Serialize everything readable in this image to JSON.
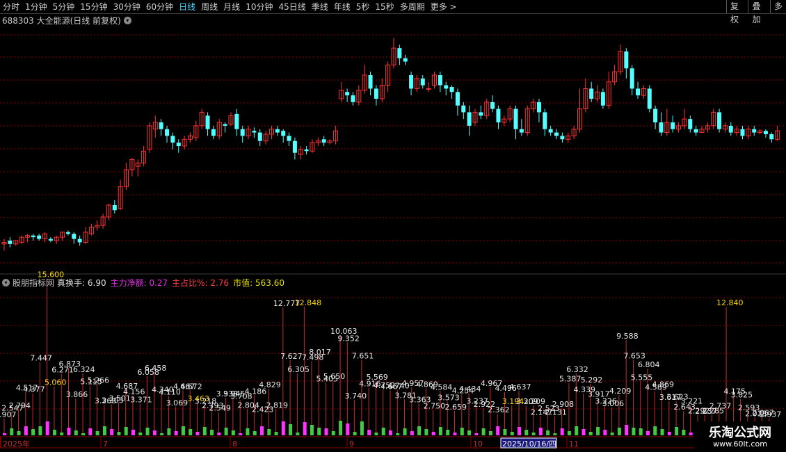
{
  "toolbar": {
    "periods": [
      "分时",
      "1分钟",
      "5分钟",
      "15分钟",
      "30分钟",
      "60分钟",
      "日线",
      "周线",
      "月线",
      "10分钟",
      "45日线",
      "季线",
      "年线",
      "5秒",
      "15秒",
      "多周期",
      "更多 >"
    ],
    "active_period": "日线",
    "right_buttons": [
      "复权",
      "叠加",
      "多"
    ]
  },
  "stock": {
    "label": "688303 大全能源(日线 前复权)"
  },
  "indicator": {
    "name": "股朋指标网",
    "items": [
      {
        "text": "真换手: 6.90",
        "color": "#e0e0e0"
      },
      {
        "text": "主力净额: 0.27",
        "color": "#e030e0"
      },
      {
        "text": "主占比%: 2.76",
        "color": "#ff4040"
      },
      {
        "text": "市值: 563.60",
        "color": "#e8e000"
      }
    ]
  },
  "colors": {
    "up": "#ff3333",
    "down": "#54ffff",
    "grid": "#8b0000",
    "bar_pink": "#ff33ff",
    "bar_green": "#43c943",
    "label_yellow": "#ffd800"
  },
  "chart_data": {
    "type": "candlestick",
    "candles": [
      [
        12,
        13,
        8,
        15
      ],
      [
        14,
        12,
        10,
        16
      ],
      [
        12,
        14,
        11,
        14
      ],
      [
        13,
        16,
        12,
        17
      ],
      [
        16,
        17,
        13,
        18
      ],
      [
        17,
        16,
        14,
        18
      ],
      [
        17,
        15,
        14,
        18
      ],
      [
        15,
        18,
        13,
        19
      ],
      [
        15,
        14,
        13,
        16
      ],
      [
        14,
        16,
        12,
        17
      ],
      [
        16,
        19,
        14,
        19
      ],
      [
        19,
        18,
        17,
        20
      ],
      [
        18,
        15,
        12,
        19
      ],
      [
        15,
        13,
        11,
        17
      ],
      [
        13,
        19,
        12,
        22
      ],
      [
        18,
        22,
        17,
        24
      ],
      [
        22,
        23,
        20,
        26
      ],
      [
        23,
        28,
        21,
        30
      ],
      [
        28,
        35,
        26,
        36
      ],
      [
        35,
        32,
        30,
        38
      ],
      [
        33,
        46,
        32,
        50
      ],
      [
        46,
        56,
        44,
        60
      ],
      [
        56,
        62,
        52,
        63
      ],
      [
        58,
        60,
        52,
        62
      ],
      [
        60,
        67,
        58,
        70
      ],
      [
        68,
        82,
        66,
        84
      ],
      [
        80,
        84,
        75,
        88
      ],
      [
        84,
        80,
        76,
        86
      ],
      [
        80,
        76,
        72,
        82
      ],
      [
        76,
        72,
        68,
        78
      ],
      [
        72,
        70,
        66,
        74
      ],
      [
        70,
        74,
        68,
        76
      ],
      [
        74,
        76,
        72,
        78
      ],
      [
        75,
        82,
        73,
        85
      ],
      [
        82,
        90,
        80,
        92
      ],
      [
        88,
        80,
        76,
        90
      ],
      [
        80,
        76,
        74,
        82
      ],
      [
        76,
        84,
        74,
        86
      ],
      [
        83,
        82,
        78,
        84
      ],
      [
        83,
        88,
        82,
        90
      ],
      [
        89,
        80,
        76,
        92
      ],
      [
        80,
        76,
        72,
        82
      ],
      [
        76,
        80,
        74,
        82
      ],
      [
        79,
        78,
        75,
        81
      ],
      [
        78,
        73,
        70,
        80
      ],
      [
        73,
        77,
        71,
        79
      ],
      [
        77,
        80,
        74,
        82
      ],
      [
        80,
        78,
        76,
        82
      ],
      [
        79,
        76,
        72,
        80
      ],
      [
        76,
        73,
        70,
        78
      ],
      [
        73,
        66,
        62,
        75
      ],
      [
        65,
        68,
        62,
        70
      ],
      [
        68,
        67,
        65,
        70
      ],
      [
        67,
        72,
        66,
        74
      ],
      [
        72,
        73,
        70,
        75
      ],
      [
        74,
        72,
        70,
        76
      ],
      [
        72,
        73,
        71,
        74
      ],
      [
        73,
        79,
        71,
        82
      ],
      [
        98,
        103,
        96,
        108
      ],
      [
        102,
        100,
        96,
        104
      ],
      [
        100,
        96,
        94,
        102
      ],
      [
        96,
        103,
        94,
        106
      ],
      [
        103,
        112,
        101,
        118
      ],
      [
        112,
        104,
        100,
        114
      ],
      [
        104,
        98,
        94,
        106
      ],
      [
        98,
        106,
        96,
        110
      ],
      [
        106,
        118,
        102,
        120
      ],
      [
        118,
        128,
        116,
        134
      ],
      [
        128,
        122,
        118,
        130
      ],
      [
        122,
        120,
        118,
        124
      ],
      [
        112,
        104,
        100,
        114
      ],
      [
        104,
        110,
        102,
        112
      ],
      [
        110,
        106,
        104,
        112
      ],
      [
        104,
        104,
        102,
        108
      ],
      [
        106,
        112,
        104,
        114
      ],
      [
        112,
        106,
        102,
        114
      ],
      [
        106,
        104,
        100,
        108
      ],
      [
        105,
        102,
        98,
        106
      ],
      [
        102,
        94,
        88,
        104
      ],
      [
        94,
        90,
        86,
        96
      ],
      [
        90,
        82,
        76,
        94
      ],
      [
        84,
        90,
        82,
        92
      ],
      [
        90,
        88,
        86,
        94
      ],
      [
        88,
        96,
        86,
        98
      ],
      [
        96,
        92,
        90,
        100
      ],
      [
        92,
        84,
        80,
        94
      ],
      [
        84,
        86,
        82,
        88
      ],
      [
        86,
        92,
        84,
        94
      ],
      [
        92,
        80,
        74,
        94
      ],
      [
        80,
        78,
        76,
        86
      ],
      [
        78,
        92,
        76,
        94
      ],
      [
        92,
        96,
        90,
        98
      ],
      [
        96,
        90,
        84,
        98
      ],
      [
        90,
        80,
        76,
        92
      ],
      [
        80,
        78,
        76,
        82
      ],
      [
        78,
        76,
        74,
        80
      ],
      [
        76,
        74,
        72,
        78
      ],
      [
        74,
        76,
        72,
        78
      ],
      [
        76,
        80,
        74,
        82
      ],
      [
        80,
        92,
        78,
        104
      ],
      [
        92,
        104,
        90,
        110
      ],
      [
        104,
        98,
        96,
        108
      ],
      [
        98,
        102,
        96,
        106
      ],
      [
        102,
        94,
        92,
        104
      ],
      [
        94,
        108,
        92,
        114
      ],
      [
        108,
        114,
        106,
        118
      ],
      [
        114,
        126,
        112,
        130
      ],
      [
        126,
        116,
        110,
        128
      ],
      [
        116,
        104,
        100,
        118
      ],
      [
        104,
        100,
        98,
        108
      ],
      [
        100,
        104,
        98,
        106
      ],
      [
        104,
        92,
        90,
        106
      ],
      [
        92,
        84,
        80,
        94
      ],
      [
        84,
        78,
        76,
        90
      ],
      [
        78,
        84,
        76,
        92
      ],
      [
        84,
        80,
        78,
        88
      ],
      [
        80,
        82,
        78,
        84
      ],
      [
        82,
        86,
        80,
        92
      ],
      [
        86,
        80,
        78,
        88
      ],
      [
        80,
        78,
        76,
        82
      ],
      [
        78,
        80,
        78,
        82
      ],
      [
        80,
        82,
        78,
        84
      ],
      [
        82,
        90,
        80,
        92
      ],
      [
        90,
        80,
        78,
        92
      ],
      [
        80,
        82,
        78,
        84
      ],
      [
        82,
        78,
        76,
        84
      ],
      [
        78,
        80,
        76,
        82
      ],
      [
        80,
        76,
        74,
        82
      ],
      [
        76,
        80,
        74,
        82
      ],
      [
        80,
        78,
        76,
        82
      ],
      [
        78,
        79,
        77,
        80
      ],
      [
        79,
        77,
        75,
        80
      ],
      [
        77,
        74,
        72,
        78
      ],
      [
        74,
        79,
        73,
        82
      ]
    ],
    "volume_labels": [
      "1.907",
      "2.547",
      "2.794",
      "4.517",
      "4.377",
      "7.447",
      "15.600",
      "5.060",
      "6.271",
      "6.873",
      "3.866",
      "6.324",
      "5.115",
      "5.266",
      "3.263",
      "3.303",
      "3.501",
      "4.687",
      "4.156",
      "3.371",
      "6.058",
      "6.458",
      "4.340",
      "4.110",
      "3.069",
      "4.667",
      "4.672",
      "3.463",
      "3.218",
      "2.793",
      "2.549",
      "3.938",
      "3.945",
      "3.708",
      "2.804",
      "4.186",
      "2.423",
      "4.829",
      "2.819",
      "12.777",
      "7.627",
      "6.305",
      "12.848",
      "7.498",
      "8.017",
      "5.405",
      "5.650",
      "10.063",
      "9.352",
      "3.740",
      "7.651",
      "4.916",
      "5.569",
      "4.752",
      "4.667",
      "4.740",
      "3.781",
      "4.957",
      "3.363",
      "4.869",
      "2.750",
      "4.584",
      "3.573",
      "2.659",
      "4.254",
      "4.434",
      "3.237",
      "2.922",
      "4.967",
      "2.362",
      "4.496",
      "3.194",
      "4.637",
      "3.209",
      "3.209",
      "2.147",
      "2.523",
      "2.131",
      "2.908",
      "5.387",
      "6.332",
      "4.339",
      "5.292",
      "3.917",
      "3.226",
      "3.006",
      "4.209",
      "9.588",
      "7.653",
      "5.555",
      "6.804",
      "4.589",
      "4.869",
      "3.617",
      "3.623",
      "2.643",
      "3.221",
      "2.292",
      "2.237",
      "2.285",
      "2.737",
      "12.840",
      "4.175",
      "3.825",
      "2.593",
      "2.013",
      "2.067",
      "1.937"
    ],
    "volume_label_colors": {
      "6": "#ffd800",
      "7": "#ffd800",
      "27": "#ffd800",
      "42": "#ffd800",
      "71": "#ffd800",
      "101": "#ffd800"
    }
  },
  "timeline": {
    "labels": [
      "2025年",
      "7",
      "8",
      "9",
      "10",
      "2025/10/16/四",
      "11"
    ]
  },
  "watermark": {
    "title": "乐淘公式网",
    "url": "www.60lt.com"
  }
}
